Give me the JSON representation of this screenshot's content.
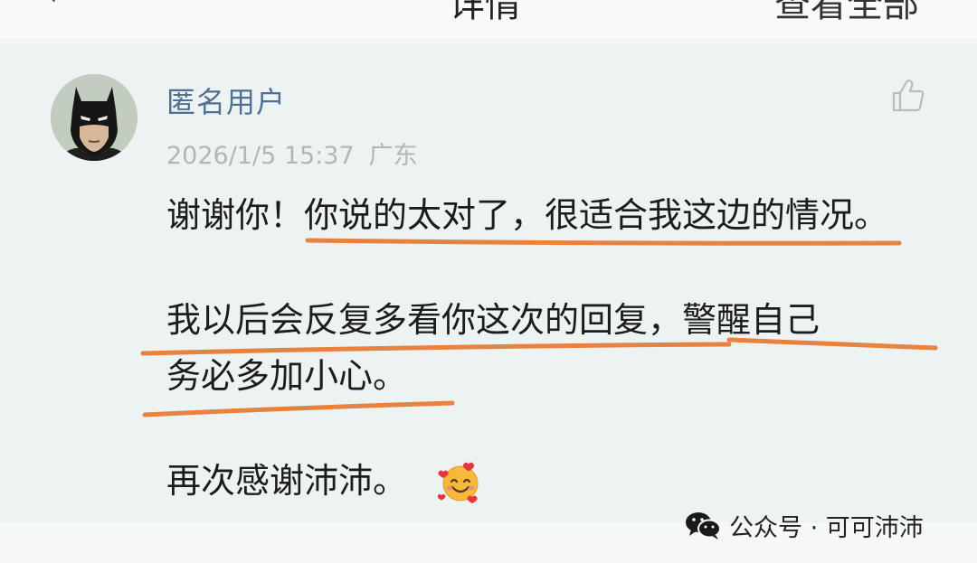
{
  "header": {
    "back_glyph": "‹",
    "title": "详情",
    "right_action": "查看全部"
  },
  "comment": {
    "username": "匿名用户",
    "timestamp": "2026/1/5 15:37",
    "location": "广东",
    "paragraphs": {
      "p1": "谢谢你！你说的太对了，很适合我这边的情况。",
      "p2_line1": "我以后会反复多看你这次的回复，警醒自己",
      "p2_line2": "务必多加小心。",
      "p3": "再次感谢沛沛。"
    },
    "emoji": "smiling-face-with-hearts"
  },
  "watermark": {
    "text": "公众号 · 可可沛沛",
    "icon": "wechat-icon"
  },
  "colors": {
    "card_bg": "#edf3f2",
    "username": "#4d7093",
    "meta": "#b3b6b8",
    "underline": "#e8823f"
  }
}
